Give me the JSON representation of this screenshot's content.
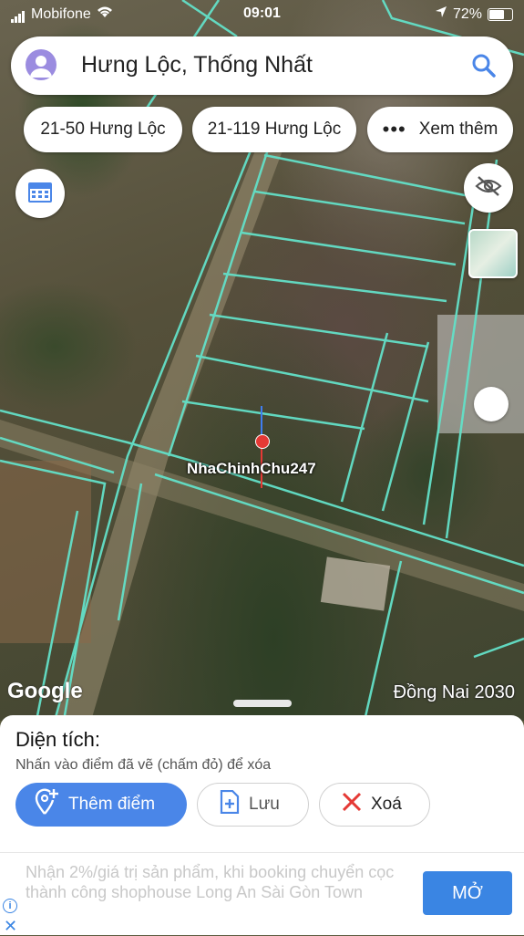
{
  "status_bar": {
    "carrier": "Mobifone",
    "time": "09:01",
    "battery": "72%"
  },
  "search": {
    "title": "Hưng Lộc, Thống Nhất"
  },
  "chips": [
    {
      "label": "21-50 Hưng Lộc"
    },
    {
      "label": "21-119 Hưng Lộc"
    },
    {
      "label": "Xem thêm"
    }
  ],
  "map": {
    "watermark": "NhaChinhChu247",
    "logo": "Google",
    "region_label": "Đồng Nai 2030"
  },
  "panel": {
    "heading": "Diện tích:",
    "hint": "Nhấn vào điểm đã vẽ (chấm đỏ) để xóa",
    "add_point_label": "Thêm điểm",
    "save_label": "Lưu",
    "delete_label": "Xoá"
  },
  "ad": {
    "text": "Nhận 2%/giá trị sản phẩm, khi booking chuyển cọc thành công shophouse Long An Sài Gòn Town",
    "cta_label": "MỞ"
  },
  "colors": {
    "accent": "#4a86e8",
    "parcel_lines": "#63e0c8",
    "delete_icon": "#e53935"
  }
}
